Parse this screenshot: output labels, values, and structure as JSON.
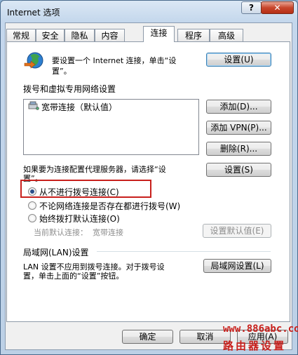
{
  "window": {
    "title": "Internet 选项",
    "help_label": "?",
    "close_label": "✕"
  },
  "tabs": [
    {
      "label": "常规"
    },
    {
      "label": "安全"
    },
    {
      "label": "隐私"
    },
    {
      "label": "内容"
    },
    {
      "label": "连接"
    },
    {
      "label": "程序"
    },
    {
      "label": "高级"
    }
  ],
  "active_tab": "连接",
  "setup": {
    "text_line1": "要设置一个 Internet 连接，单击“设",
    "text_line2": "置”。",
    "button": "设置(U)"
  },
  "dialup": {
    "section_title": "拨号和虚拟专用网络设置",
    "list_items": [
      {
        "label": "宽带连接（默认值）"
      }
    ],
    "add_button": "添加(D)...",
    "add_vpn_button": "添加 VPN(P)...",
    "delete_button": "删除(R)...",
    "proxy_text_line1": "如果要为连接配置代理服务器，请选择“设",
    "proxy_text_line2": "置”。",
    "settings_button": "设置(S)",
    "options": [
      {
        "label": "从不进行拨号连接(C)",
        "checked": true
      },
      {
        "label": "不论网络连接是否存在都进行拨号(W)",
        "checked": false
      },
      {
        "label": "始终拨打默认连接(O)",
        "checked": false
      }
    ],
    "current_default_label": "当前默认连接：",
    "current_default_value": "宽带连接",
    "set_default_button": "设置默认值(E)"
  },
  "lan": {
    "section_title": "局域网(LAN)设置",
    "text_line1": "LAN 设置不应用到拨号连接。对于拨号设",
    "text_line2": "置，单击上面的“设置”按钮。",
    "button": "局域网设置(L)"
  },
  "footer": {
    "ok": "确定",
    "cancel": "取消",
    "apply": "应用(A)"
  },
  "watermark": {
    "url": "www.886abc.com",
    "name": "路由器设置"
  },
  "colors": {
    "highlight_box": "#c8201c",
    "focus_border": "#3c7fb1"
  },
  "icons": [
    "globe-network-icon",
    "broadband-connection-icon"
  ]
}
